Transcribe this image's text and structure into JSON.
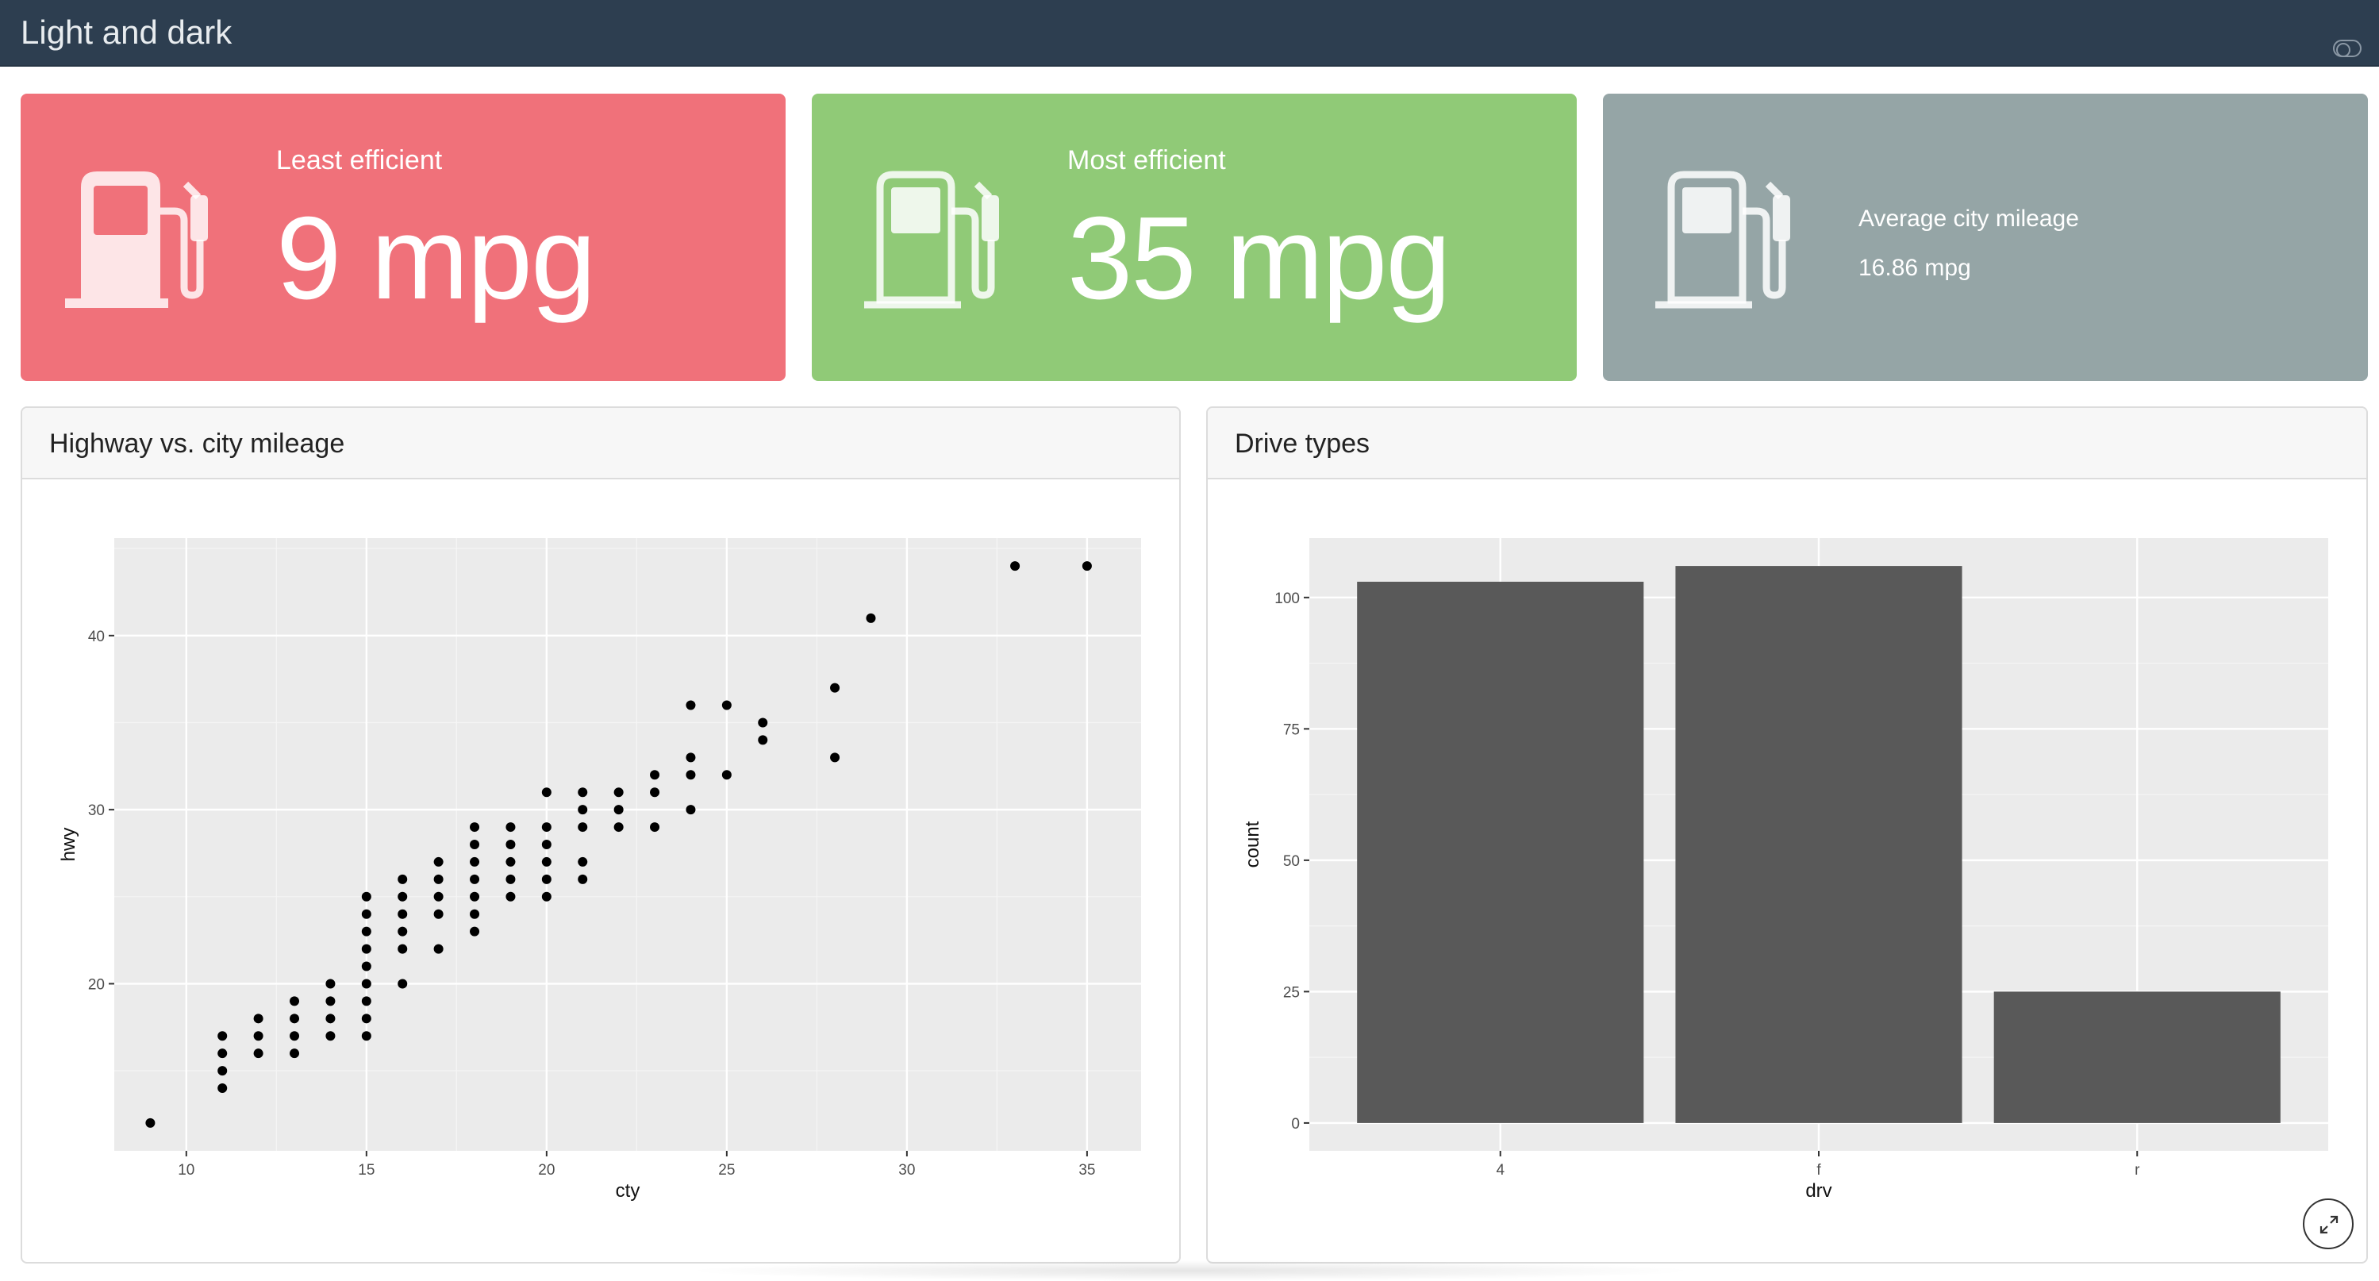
{
  "navbar": {
    "title": "Light and dark"
  },
  "value_boxes": [
    {
      "title": "Least efficient",
      "value": "9 mpg",
      "icon": "fuel-pump-fill-icon",
      "color": "#f0717a"
    },
    {
      "title": "Most efficient",
      "value": "35 mpg",
      "icon": "fuel-pump-icon",
      "color": "#90ca77"
    },
    {
      "title": "Average city mileage",
      "value": "16.86 mpg",
      "icon": "fuel-pump-icon",
      "color": "#95a5a6"
    }
  ],
  "cards": {
    "scatter": {
      "title": "Highway vs. city mileage"
    },
    "bar": {
      "title": "Drive types"
    }
  },
  "chart_data": [
    {
      "type": "scatter",
      "xlabel": "cty",
      "ylabel": "hwy",
      "xlim": [
        8,
        36.5
      ],
      "ylim": [
        10.4,
        45.6
      ],
      "xticks": [
        10,
        15,
        20,
        25,
        30,
        35
      ],
      "yticks": [
        20,
        30,
        40
      ],
      "grid": true,
      "points": [
        [
          9,
          12
        ],
        [
          11,
          14
        ],
        [
          11,
          15
        ],
        [
          11,
          16
        ],
        [
          11,
          17
        ],
        [
          12,
          16
        ],
        [
          12,
          17
        ],
        [
          12,
          18
        ],
        [
          13,
          16
        ],
        [
          13,
          17
        ],
        [
          13,
          18
        ],
        [
          13,
          19
        ],
        [
          14,
          17
        ],
        [
          14,
          18
        ],
        [
          14,
          19
        ],
        [
          14,
          20
        ],
        [
          15,
          17
        ],
        [
          15,
          18
        ],
        [
          15,
          19
        ],
        [
          15,
          20
        ],
        [
          15,
          21
        ],
        [
          15,
          22
        ],
        [
          15,
          23
        ],
        [
          15,
          24
        ],
        [
          15,
          25
        ],
        [
          16,
          20
        ],
        [
          16,
          22
        ],
        [
          16,
          23
        ],
        [
          16,
          24
        ],
        [
          16,
          25
        ],
        [
          16,
          26
        ],
        [
          17,
          22
        ],
        [
          17,
          24
        ],
        [
          17,
          25
        ],
        [
          17,
          26
        ],
        [
          17,
          27
        ],
        [
          18,
          23
        ],
        [
          18,
          24
        ],
        [
          18,
          25
        ],
        [
          18,
          26
        ],
        [
          18,
          27
        ],
        [
          18,
          28
        ],
        [
          18,
          29
        ],
        [
          19,
          25
        ],
        [
          19,
          26
        ],
        [
          19,
          27
        ],
        [
          19,
          28
        ],
        [
          19,
          29
        ],
        [
          20,
          25
        ],
        [
          20,
          26
        ],
        [
          20,
          27
        ],
        [
          20,
          28
        ],
        [
          20,
          29
        ],
        [
          20,
          31
        ],
        [
          21,
          26
        ],
        [
          21,
          27
        ],
        [
          21,
          29
        ],
        [
          21,
          30
        ],
        [
          21,
          31
        ],
        [
          22,
          29
        ],
        [
          22,
          30
        ],
        [
          22,
          31
        ],
        [
          23,
          29
        ],
        [
          23,
          31
        ],
        [
          23,
          32
        ],
        [
          24,
          30
        ],
        [
          24,
          32
        ],
        [
          24,
          33
        ],
        [
          24,
          36
        ],
        [
          25,
          32
        ],
        [
          25,
          36
        ],
        [
          26,
          34
        ],
        [
          26,
          35
        ],
        [
          28,
          33
        ],
        [
          28,
          37
        ],
        [
          29,
          41
        ],
        [
          33,
          44
        ],
        [
          35,
          44
        ]
      ]
    },
    {
      "type": "bar",
      "xlabel": "drv",
      "ylabel": "count",
      "categories": [
        "4",
        "f",
        "r"
      ],
      "values": [
        103,
        106,
        25
      ],
      "ylim": [
        -5.3,
        111.3
      ],
      "yticks": [
        0,
        25,
        50,
        75,
        100
      ],
      "bar_color": "#595959",
      "grid": true
    }
  ]
}
